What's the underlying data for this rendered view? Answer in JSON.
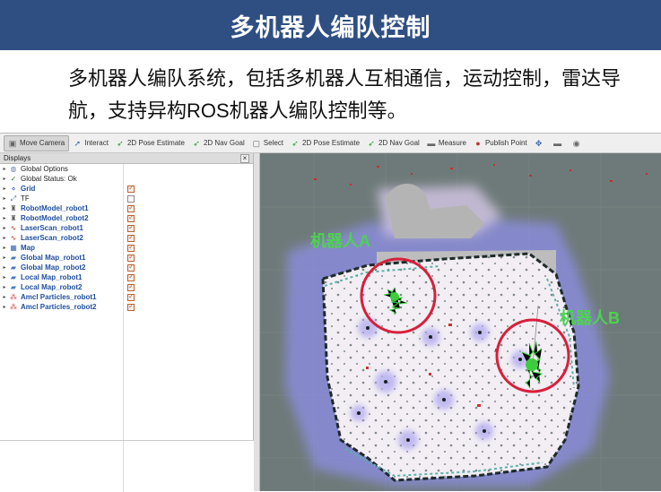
{
  "banner": {
    "title": "多机器人编队控制"
  },
  "description": "多机器人编队系统，包括多机器人互相通信，运动控制，雷达导航，支持异构ROS机器人编队控制等。",
  "toolbar": [
    {
      "label": "Move Camera",
      "icon": "camera-icon",
      "active": true
    },
    {
      "label": "Interact",
      "icon": "cursor-icon"
    },
    {
      "label": "2D Pose Estimate",
      "icon": "pose-arrow-icon"
    },
    {
      "label": "2D Nav Goal",
      "icon": "nav-arrow-icon"
    },
    {
      "label": "Select",
      "icon": "select-icon"
    },
    {
      "label": "2D Pose Estimate",
      "icon": "pose-arrow-icon"
    },
    {
      "label": "2D Nav Goal",
      "icon": "nav-arrow-icon"
    },
    {
      "label": "Measure",
      "icon": "ruler-icon"
    },
    {
      "label": "Publish Point",
      "icon": "pin-icon"
    }
  ],
  "displays": {
    "title": "Displays",
    "items": [
      {
        "label": "Global Options",
        "icon": "globe-icon",
        "checkbox": null,
        "blue": false
      },
      {
        "label": "Global Status: Ok",
        "icon": "check-icon",
        "checkbox": null,
        "blue": false
      },
      {
        "label": "Grid",
        "icon": "grid-icon",
        "checkbox": true,
        "blue": true
      },
      {
        "label": "TF",
        "icon": "tf-icon",
        "checkbox": false,
        "blue": false
      },
      {
        "label": "RobotModel_robot1",
        "icon": "robot-icon",
        "checkbox": true,
        "blue": true
      },
      {
        "label": "RobotModel_robot2",
        "icon": "robot-icon",
        "checkbox": true,
        "blue": true
      },
      {
        "label": "LaserScan_robot1",
        "icon": "laser-icon",
        "checkbox": true,
        "blue": true
      },
      {
        "label": "LaserScan_robot2",
        "icon": "laser-icon",
        "checkbox": true,
        "blue": true
      },
      {
        "label": "Map",
        "icon": "map-icon",
        "checkbox": true,
        "blue": true
      },
      {
        "label": "Global Map_robot1",
        "icon": "folder-icon",
        "checkbox": true,
        "blue": true
      },
      {
        "label": "Global Map_robot2",
        "icon": "folder-icon",
        "checkbox": true,
        "blue": true
      },
      {
        "label": "Local Map_robot1",
        "icon": "folder-icon",
        "checkbox": true,
        "blue": true
      },
      {
        "label": "Local Map_robot2",
        "icon": "folder-icon",
        "checkbox": true,
        "blue": true
      },
      {
        "label": "Amcl Particles_robot1",
        "icon": "particles-icon",
        "checkbox": true,
        "blue": true
      },
      {
        "label": "Amcl Particles_robot2",
        "icon": "particles-icon",
        "checkbox": true,
        "blue": true
      }
    ]
  },
  "map": {
    "robot_a_label": "机器人A",
    "robot_b_label": "机器人B",
    "highlight_color": "#d81f3a",
    "label_color": "#4cd44c"
  }
}
